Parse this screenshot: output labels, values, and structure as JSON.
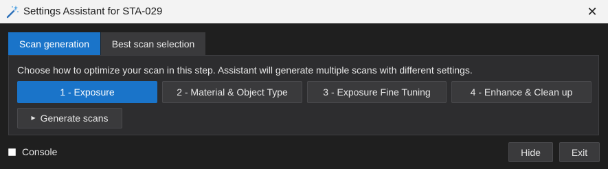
{
  "window": {
    "title": "Settings Assistant for STA-029",
    "close_glyph": "✕",
    "icon": "magic-wand-icon"
  },
  "tabs": [
    {
      "label": "Scan generation",
      "active": true
    },
    {
      "label": "Best scan selection",
      "active": false
    }
  ],
  "panel": {
    "instructions": "Choose how to optimize your scan in this step. Assistant will generate multiple scans with different settings.",
    "steps": [
      {
        "label": "1 - Exposure",
        "selected": true
      },
      {
        "label": "2 - Material & Object Type",
        "selected": false
      },
      {
        "label": "3 - Exposure Fine Tuning",
        "selected": false
      },
      {
        "label": "4 - Enhance & Clean up",
        "selected": false
      }
    ],
    "generate_label": "Generate scans",
    "generate_glyph": "▶"
  },
  "footer": {
    "console_label": "Console",
    "console_checked": false,
    "hide_label": "Hide",
    "exit_label": "Exit"
  },
  "colors": {
    "accent": "#1a74c9",
    "background": "#1f1f1f",
    "panel": "#2d2d2f",
    "button": "#3a3a3c"
  }
}
